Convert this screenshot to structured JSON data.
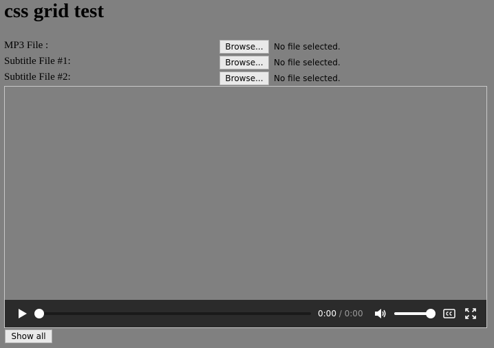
{
  "page": {
    "title": "css grid test",
    "background": "#808080"
  },
  "form": {
    "rows": [
      {
        "label": "MP3 File :",
        "button_label": "Browse...",
        "status": "No file selected."
      },
      {
        "label": "Subtitle File #1:",
        "button_label": "Browse...",
        "status": "No file selected."
      },
      {
        "label": "Subtitle File #2:",
        "button_label": "Browse...",
        "status": "No file selected."
      }
    ]
  },
  "player": {
    "current_time": "0:00",
    "separator": " / ",
    "duration": "0:00",
    "progress": 0,
    "volume": 1,
    "icons": {
      "play": "play-icon",
      "volume": "volume-icon",
      "captions": "closed-captions-icon",
      "fullscreen": "fullscreen-icon"
    },
    "controls_background": "#2b2b2b"
  },
  "footer": {
    "show_all_label": "Show all"
  }
}
